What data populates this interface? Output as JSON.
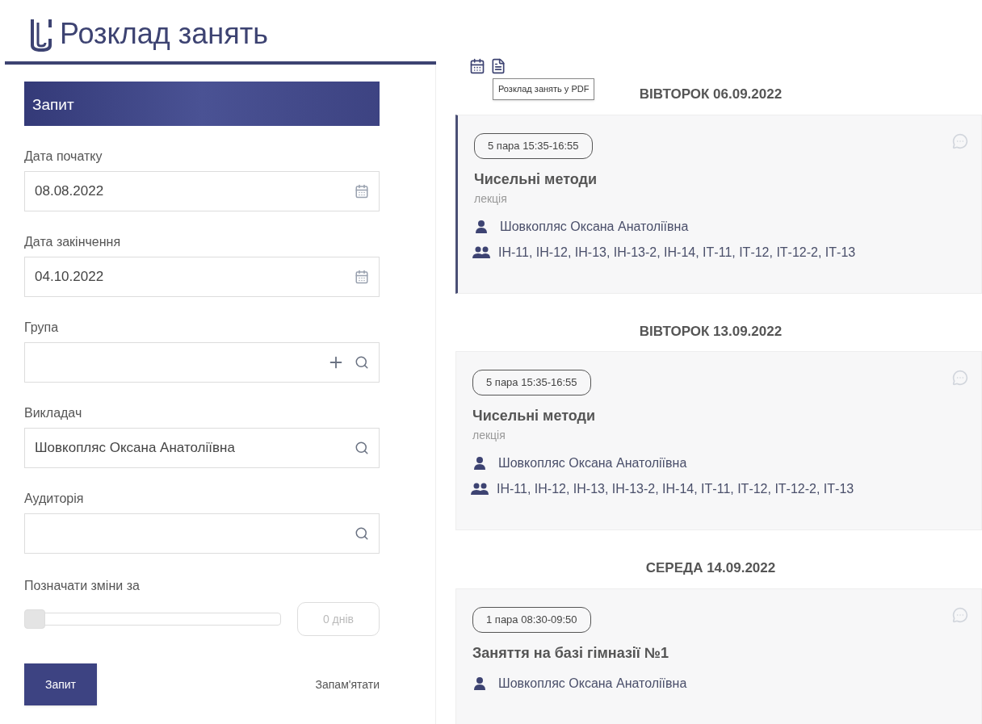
{
  "header": {
    "title": "Розклад занять"
  },
  "toolbar": {
    "tooltip": "Розклад занять у PDF"
  },
  "query_panel": {
    "title": "Запит",
    "fields": [
      {
        "kind": "date",
        "label": "Дата початку",
        "value": "08.08.2022"
      },
      {
        "kind": "date",
        "label": "Дата закінчення",
        "value": "04.10.2022"
      },
      {
        "kind": "group",
        "label": "Група"
      },
      {
        "kind": "search",
        "label": "Викладач",
        "value": "Шовкопляс Оксана Анатоліївна"
      },
      {
        "kind": "search",
        "label": "Аудиторія"
      }
    ],
    "changes": {
      "label": "Позначати зміни за",
      "level": 0,
      "reading": "0 днів"
    },
    "submit": "Запит",
    "remember": "Запам'ятати"
  },
  "days": [
    {
      "heading": "ВІВТОРОК 06.09.2022",
      "lessons": [
        {
          "selected": true,
          "time": "5 пара 15:35-16:55",
          "subject": "Чисельні методи",
          "type": "лекція",
          "teacher": "Шовкопляс Оксана Анатоліївна",
          "groups": "ІН-11, ІН-12, ІН-13, ІН-13-2, ІН-14, ІТ-11, ІТ-12, ІТ-12-2, ІТ-13"
        }
      ]
    },
    {
      "heading": "ВІВТОРОК 13.09.2022",
      "lessons": [
        {
          "selected": false,
          "time": "5 пара 15:35-16:55",
          "subject": "Чисельні методи",
          "type": "лекція",
          "teacher": "Шовкопляс Оксана Анатоліївна",
          "groups": "ІН-11, ІН-12, ІН-13, ІН-13-2, ІН-14, ІТ-11, ІТ-12, ІТ-12-2, ІТ-13"
        }
      ]
    },
    {
      "heading": "СЕРЕДА 14.09.2022",
      "lessons": [
        {
          "selected": false,
          "time": "1 пара 08:30-09:50",
          "subject": "Заняття на базі гімназії №1",
          "teacher": "Шовкопляс Оксана Анатоліївна"
        }
      ]
    }
  ]
}
